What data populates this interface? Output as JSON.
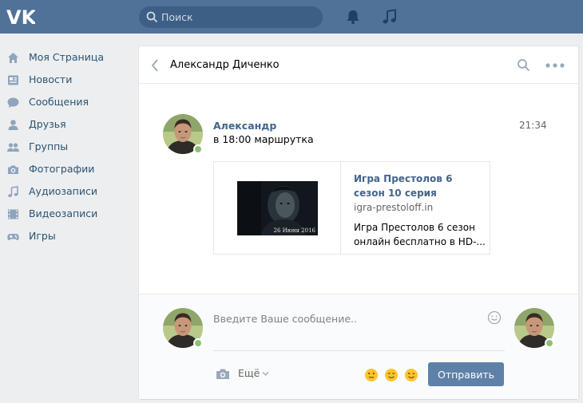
{
  "header": {
    "logo": "vk-logo",
    "search": {
      "placeholder": "Поиск",
      "icon": "search-icon"
    },
    "icons": [
      "bell-icon",
      "music-note-icon"
    ]
  },
  "sidebar": {
    "items": [
      {
        "label": "Моя Страница",
        "icon": "home-icon"
      },
      {
        "label": "Новости",
        "icon": "news-icon"
      },
      {
        "label": "Сообщения",
        "icon": "messages-icon"
      },
      {
        "label": "Друзья",
        "icon": "friend-icon"
      },
      {
        "label": "Группы",
        "icon": "groups-icon"
      },
      {
        "label": "Фотографии",
        "icon": "camera-icon"
      },
      {
        "label": "Аудиозаписи",
        "icon": "music-note-icon"
      },
      {
        "label": "Видеозаписи",
        "icon": "film-icon"
      },
      {
        "label": "Игры",
        "icon": "gamepad-icon"
      }
    ]
  },
  "chat": {
    "title": "Александр Диченко",
    "message": {
      "author": "Александр",
      "time": "21:34",
      "text": "в 18:00 маршрутка",
      "link_card": {
        "image_caption": "26 Июня 2016",
        "title": "Игра Престолов 6 сезон 10 серия",
        "domain": "igra-prestoloff.in",
        "description": "Игра Престолов 6 сезон онлайн бесплатно в HD-..."
      }
    },
    "compose": {
      "placeholder": "Введите Ваше сообщение..",
      "more_label": "Ещё",
      "send_label": "Отправить"
    }
  },
  "colors": {
    "header": "#507299",
    "link": "#42648b",
    "nav_text": "#285473",
    "send_button": "#5e81a8",
    "online": "#8ac176",
    "page_background": "#edeef0"
  }
}
